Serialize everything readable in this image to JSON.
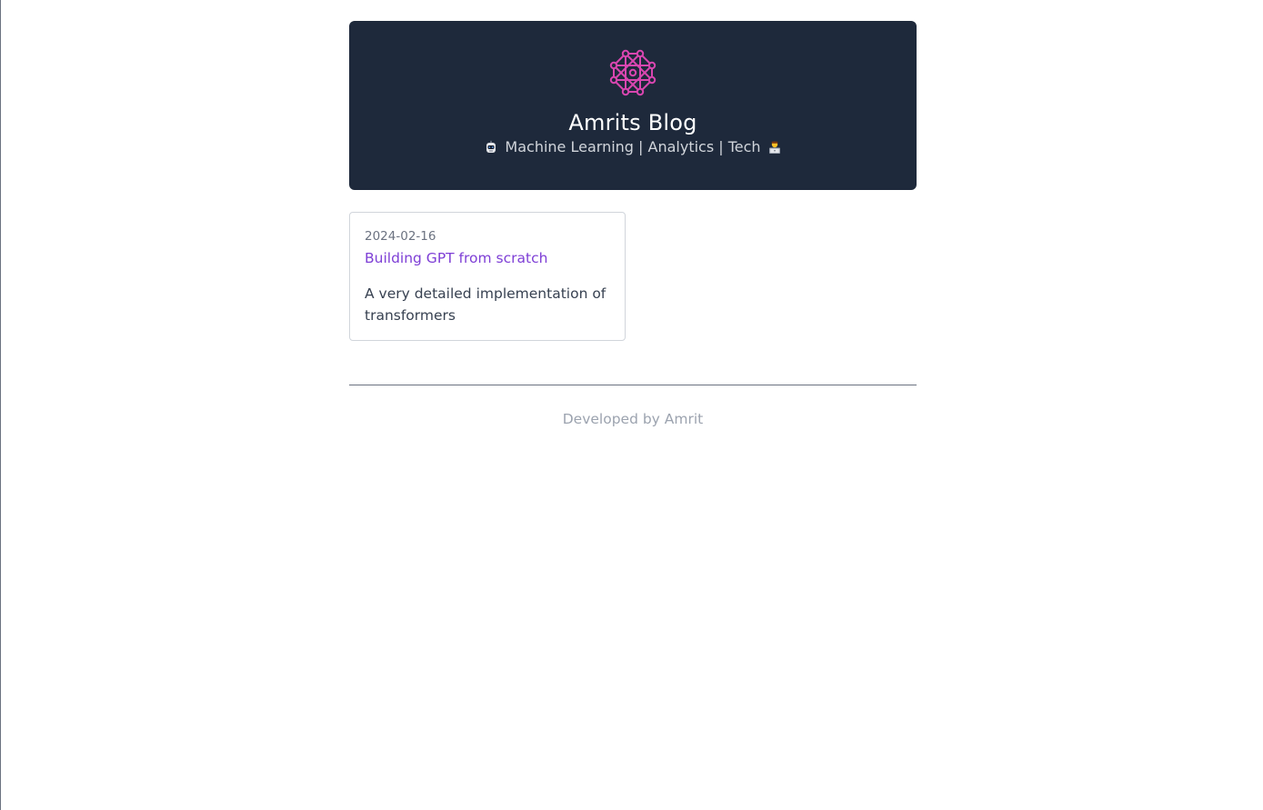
{
  "header": {
    "title": "Amrits Blog",
    "tagline": "Machine Learning | Analytics | Tech",
    "logo_icon": "neural-network-icon",
    "colors": {
      "background": "#1e293b",
      "logo": "#d946b0"
    }
  },
  "posts": [
    {
      "date": "2024-02-16",
      "title": "Building GPT from scratch",
      "description": "A very detailed implementation of transformers"
    }
  ],
  "footer": {
    "text": "Developed by Amrit"
  },
  "colors": {
    "link": "#7e3fd6"
  }
}
